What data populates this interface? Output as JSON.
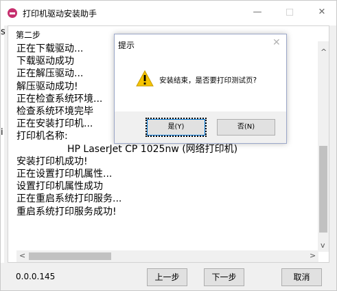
{
  "window": {
    "title": "打印机驱动安装助手",
    "controls": {
      "minimize": "—",
      "maximize": "□",
      "close": "✕"
    }
  },
  "log": {
    "step": "第二步",
    "lines": [
      "正在下载驱动...",
      "下载驱动成功",
      "正在解压驱动...",
      "解压驱动成功!",
      "正在检查系统环境...",
      "检查系统环境完毕",
      "正在安装打印机...",
      "打印机名称:",
      "HP LaserJet CP 1025nw (网络打印机)",
      "安装打印机成功!",
      "正在设置打印机属性...",
      "设置打印机属性成功",
      "正在重启系统打印服务...",
      "重启系统打印服务成功!"
    ]
  },
  "scrollbar": {
    "up": "^",
    "down": "v",
    "left": "<",
    "right": ">"
  },
  "footer": {
    "version": "0.0.0.145",
    "prev_label": "上一步",
    "next_label": "下一步",
    "cancel_label": "取消"
  },
  "dialog": {
    "title": "提示",
    "close": "✕",
    "message": "安装结束，是否要打印测试页?",
    "yes_label": "是(Y)",
    "no_label": "否(N)"
  },
  "edge_chars": [
    "s",
    "i"
  ],
  "icons": {
    "app": "printer-app-icon",
    "warning": "warning-icon"
  },
  "colors": {
    "accent": "#0078d7",
    "warning": "#f6c400",
    "app_icon": "#c62f6e"
  }
}
